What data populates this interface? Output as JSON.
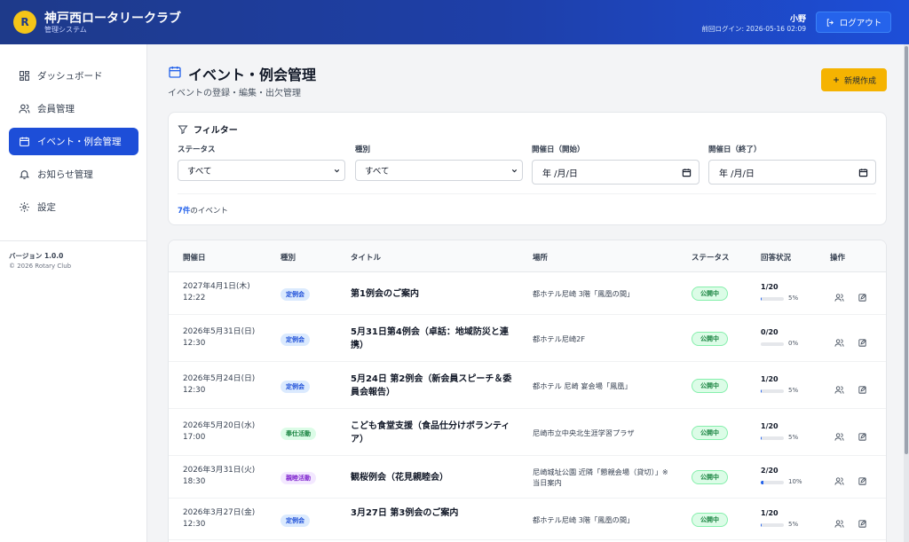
{
  "header": {
    "logo_letter": "R",
    "title": "神戸西ロータリークラブ",
    "subtitle": "管理システム",
    "user_name": "小野",
    "last_login": "前回ログイン: 2026-05-16 02:09",
    "logout_label": "ログアウト"
  },
  "sidebar": {
    "items": [
      {
        "label": "ダッシュボード",
        "icon": "dashboard-icon"
      },
      {
        "label": "会員管理",
        "icon": "users-icon"
      },
      {
        "label": "イベント・例会管理",
        "icon": "calendar-icon",
        "active": true
      },
      {
        "label": "お知らせ管理",
        "icon": "bell-icon"
      },
      {
        "label": "設定",
        "icon": "gear-icon"
      }
    ],
    "version": "バージョン 1.0.0",
    "copyright": "© 2026 Rotary Club"
  },
  "page": {
    "title": "イベント・例会管理",
    "subtitle": "イベントの登録・編集・出欠管理",
    "new_button": "新規作成"
  },
  "filter": {
    "title": "フィルター",
    "status_label": "ステータス",
    "status_value": "すべて",
    "type_label": "種別",
    "type_value": "すべて",
    "start_label": "開催日（開始）",
    "start_value": "年 /月/日",
    "end_label": "開催日（終了）",
    "end_value": "年 /月/日",
    "count_number": "7件",
    "count_suffix": "のイベント"
  },
  "table": {
    "headers": [
      "開催日",
      "種別",
      "タイトル",
      "場所",
      "ステータス",
      "回答状況",
      "操作"
    ],
    "rows": [
      {
        "date": "2027年4月1日(木)",
        "time": "12:22",
        "type": "定例会",
        "type_color": "blue",
        "title": "第1例会のご案内",
        "place": "都ホテル尼崎 3階「鳳凰の間」",
        "status": "公開中",
        "response": "1/20",
        "ratio": 0.05,
        "pct": "5%"
      },
      {
        "date": "2026年5月31日(日)",
        "time": "12:30",
        "type": "定例会",
        "type_color": "blue",
        "title": "5月31日第4例会（卓話：地域防災と連携）",
        "place": "都ホテル尼崎2F",
        "status": "公開中",
        "response": "0/20",
        "ratio": 0.0,
        "pct": "0%"
      },
      {
        "date": "2026年5月24日(日)",
        "time": "12:30",
        "type": "定例会",
        "type_color": "blue",
        "title": "5月24日 第2例会（新会員スピーチ＆委員会報告）",
        "place": "都ホテル 尼崎 宴会場「鳳凰」",
        "status": "公開中",
        "response": "1/20",
        "ratio": 0.05,
        "pct": "5%"
      },
      {
        "date": "2026年5月20日(水)",
        "time": "17:00",
        "type": "奉仕活動",
        "type_color": "green",
        "title": "こども食堂支援（食品仕分けボランティア）",
        "place": "尼崎市立中央北生涯学習プラザ",
        "status": "公開中",
        "response": "1/20",
        "ratio": 0.05,
        "pct": "5%"
      },
      {
        "date": "2026年3月31日(火)",
        "time": "18:30",
        "type": "親睦活動",
        "type_color": "purple",
        "title": "観桜例会（花見親睦会）",
        "place": "尼崎城址公園 近隣「懇親会場（貸切）」※当日案内",
        "status": "公開中",
        "response": "2/20",
        "ratio": 0.1,
        "pct": "10%"
      },
      {
        "date": "2026年3月27日(金)",
        "time": "12:30",
        "type": "定例会",
        "type_color": "blue",
        "title": "3月27日 第3例会のご案内",
        "place": "都ホテル尼崎 3階「鳳凰の間」",
        "status": "公開中",
        "response": "1/20",
        "ratio": 0.05,
        "pct": "5%"
      }
    ]
  }
}
